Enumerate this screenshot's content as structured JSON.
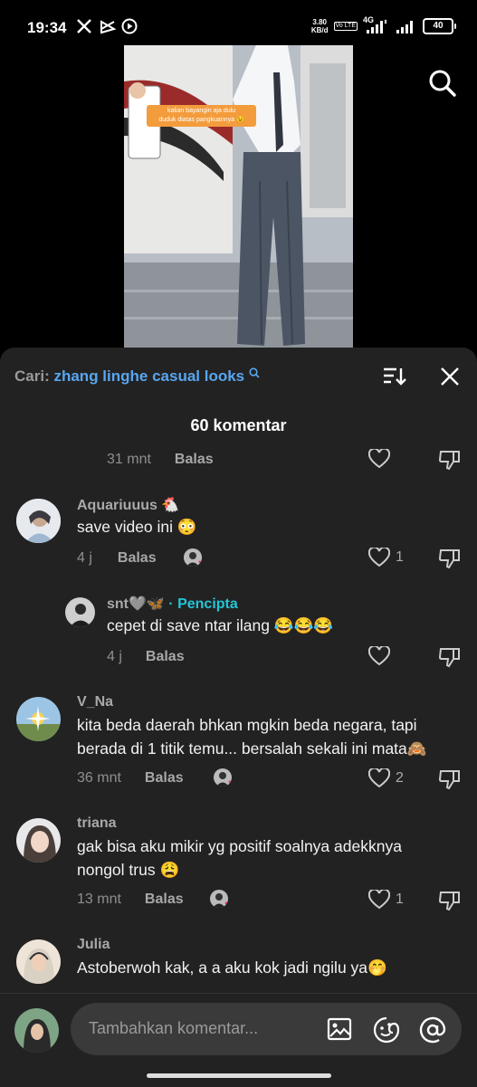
{
  "status_bar": {
    "time": "19:34",
    "net_speed_top": "3.80",
    "net_speed_bottom": "KB/d",
    "volte": "Vo LTE",
    "net_type": "4G",
    "battery": "40"
  },
  "video": {
    "caption_line1": "kalian bayangin aja dulu",
    "caption_line2": "duduk diatas pangkuannya 😉"
  },
  "search": {
    "label": "Cari:",
    "query": "zhang linghe casual looks"
  },
  "comments_header": {
    "count": "60 komentar"
  },
  "reply_label": "Balas",
  "first_meta": {
    "time": "31 mnt"
  },
  "comments": [
    {
      "user": "Aquariuuus 🐔",
      "text": "save video ini 😳",
      "time": "4 j",
      "likes": "1"
    },
    {
      "user": "snt🩶🦋",
      "badge": "· Pencipta",
      "text": "cepet di save ntar ilang 😂😂😂",
      "time": "4 j",
      "likes": ""
    },
    {
      "user": "V_Na",
      "text1": "kita beda daerah bhkan mgkin beda negara, tapi",
      "text2": "berada di 1 titik temu... bersalah sekali ini mata🙈",
      "time": "36 mnt",
      "likes": "2"
    },
    {
      "user": "triana",
      "text1": "gak bisa aku mikir yg positif soalnya adekknya",
      "text2": "nongol trus 😩",
      "time": "13 mnt",
      "likes": "1"
    },
    {
      "user": "Julia",
      "text": "Astoberwoh kak, a a aku kok jadi ngilu ya🤭"
    }
  ],
  "input": {
    "placeholder": "Tambahkan komentar..."
  },
  "colors": {
    "sheet": "#222222",
    "link": "#58a6f0",
    "creator": "#24c5d6",
    "heart_red": "#fe2c55"
  }
}
